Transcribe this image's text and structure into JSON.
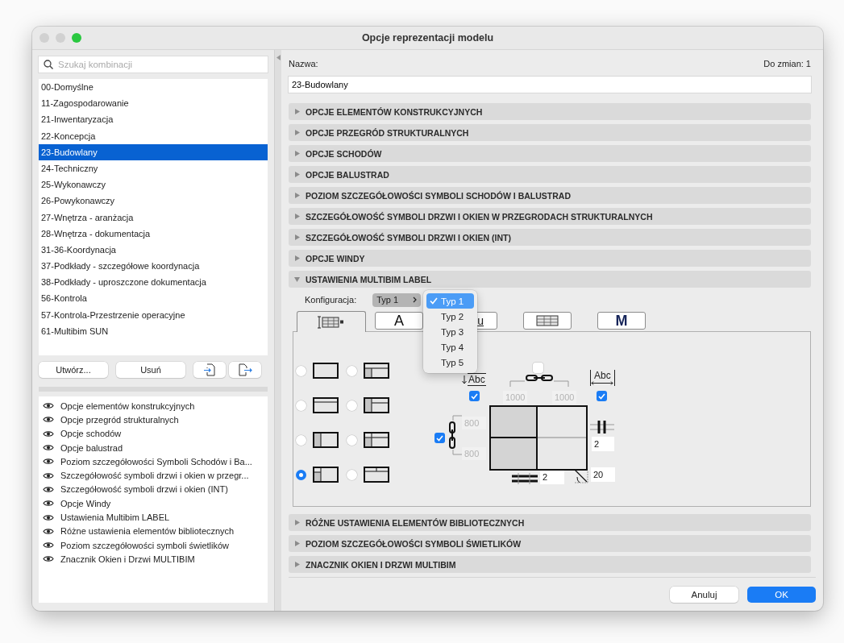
{
  "window": {
    "title": "Opcje reprezentacji modelu"
  },
  "search": {
    "placeholder": "Szukaj kombinacji"
  },
  "combinations": [
    {
      "label": "00-Domyślne",
      "selected": false
    },
    {
      "label": "11-Zagospodarowanie",
      "selected": false
    },
    {
      "label": "21-Inwentaryzacja",
      "selected": false
    },
    {
      "label": "22-Koncepcja",
      "selected": false
    },
    {
      "label": "23-Budowlany",
      "selected": true
    },
    {
      "label": "24-Techniczny",
      "selected": false
    },
    {
      "label": "25-Wykonawczy",
      "selected": false
    },
    {
      "label": "26-Powykonawczy",
      "selected": false
    },
    {
      "label": "27-Wnętrza - aranżacja",
      "selected": false
    },
    {
      "label": "28-Wnętrza - dokumentacja",
      "selected": false
    },
    {
      "label": "31-36-Koordynacja",
      "selected": false
    },
    {
      "label": "37-Podkłady - szczegółowe koordynacja",
      "selected": false
    },
    {
      "label": "38-Podkłady - uproszczone dokumentacja",
      "selected": false
    },
    {
      "label": "56-Kontrola",
      "selected": false
    },
    {
      "label": "57-Kontrola-Przestrzenie operacyjne",
      "selected": false
    },
    {
      "label": "61-Multibim SUN",
      "selected": false
    }
  ],
  "combination_buttons": [
    "Utwórz...",
    "Usuń"
  ],
  "layers": [
    {
      "label": "Opcje elementów konstrukcyjnych"
    },
    {
      "label": "Opcje przegród strukturalnych"
    },
    {
      "label": "Opcje schodów"
    },
    {
      "label": "Opcje balustrad"
    },
    {
      "label": "Poziom szczegółowości Symboli Schodów i Ba..."
    },
    {
      "label": "Szczegółowość symboli drzwi i okien w przegr..."
    },
    {
      "label": "Szczegółowość symboli drzwi i okien (INT)"
    },
    {
      "label": "Opcje Windy"
    },
    {
      "label": "Ustawienia Multibim LABEL"
    },
    {
      "label": "Różne ustawienia elementów bibliotecznych"
    },
    {
      "label": "Poziom szczegółowości symboli świetlików"
    },
    {
      "label": "Znacznik Okien i Drzwi MULTIBIM"
    }
  ],
  "name": {
    "label": "Nazwa:",
    "value": "23-Budowlany"
  },
  "changes": "Do zmian: 1",
  "sections": [
    {
      "title": "OPCJE ELEMENTÓW KONSTRUKCYJNYCH",
      "expanded": false
    },
    {
      "title": "OPCJE PRZEGRÓD STRUKTURALNYCH",
      "expanded": false
    },
    {
      "title": "OPCJE SCHODÓW",
      "expanded": false
    },
    {
      "title": "OPCJE BALUSTRAD",
      "expanded": false
    },
    {
      "title": "POZIOM SZCZEGÓŁOWOŚCI SYMBOLI SCHODÓW I BALUSTRAD",
      "expanded": false
    },
    {
      "title": "SZCZEGÓŁOWOŚĆ SYMBOLI DRZWI I OKIEN W PRZEGRODACH STRUKTURALNYCH",
      "expanded": false
    },
    {
      "title": "SZCZEGÓŁOWOŚĆ SYMBOLI DRZWI I OKIEN (INT)",
      "expanded": false
    },
    {
      "title": "OPCJE WINDY",
      "expanded": false
    },
    {
      "title": "USTAWIENIA MULTIBIM LABEL",
      "expanded": true
    },
    {
      "title": "RÓŻNE USTAWIENIA ELEMENTÓW BIBLIOTECZNYCH",
      "expanded": false
    },
    {
      "title": "POZIOM SZCZEGÓŁOWOŚCI SYMBOLI ŚWIETLIKÓW",
      "expanded": false
    },
    {
      "title": "ZNACZNIK OKIEN I DRZWI MULTIBIM",
      "expanded": false
    }
  ],
  "multibim": {
    "config_label": "Konfiguracja:",
    "config_value": "Typ 1",
    "menu": [
      {
        "label": "Typ 1",
        "selected": true
      },
      {
        "label": "Typ 2",
        "selected": false
      },
      {
        "label": "Typ 3",
        "selected": false
      },
      {
        "label": "Typ 4",
        "selected": false
      },
      {
        "label": "Typ 5",
        "selected": false
      }
    ],
    "tabs": [
      {
        "kind": "table-icon",
        "selected": true
      },
      {
        "kind": "text",
        "label": "A",
        "selected": false
      },
      {
        "kind": "underline",
        "label": "u",
        "selected": false
      },
      {
        "kind": "grid-icon",
        "selected": false
      },
      {
        "kind": "logo",
        "label": "M",
        "selected": false
      }
    ],
    "layouts": [
      {
        "kind": "plain",
        "selected": false
      },
      {
        "kind": "header-left",
        "selected": false
      },
      {
        "kind": "header",
        "selected": false
      },
      {
        "kind": "left-header",
        "selected": false
      },
      {
        "kind": "left",
        "selected": false
      },
      {
        "kind": "grid",
        "selected": false
      },
      {
        "kind": "left-split",
        "selected": true
      },
      {
        "kind": "header-split",
        "selected": false
      }
    ],
    "diagram": {
      "width_link": {
        "checked": false
      },
      "text_down": {
        "label": "Abc",
        "checked": true
      },
      "text_fit": {
        "label": "Abc",
        "checked": true
      },
      "height_link": {
        "checked": true
      },
      "widths": [
        {
          "value": "1000",
          "disabled": true
        },
        {
          "value": "1000",
          "disabled": true
        }
      ],
      "heights": [
        {
          "value": "800",
          "disabled": true
        },
        {
          "value": "800",
          "disabled": true
        }
      ],
      "column_lines": "2",
      "row_lines": "2",
      "angle": "20"
    }
  },
  "footer_buttons": [
    {
      "label": "Anuluj",
      "primary": false
    },
    {
      "label": "OK",
      "primary": true
    }
  ]
}
